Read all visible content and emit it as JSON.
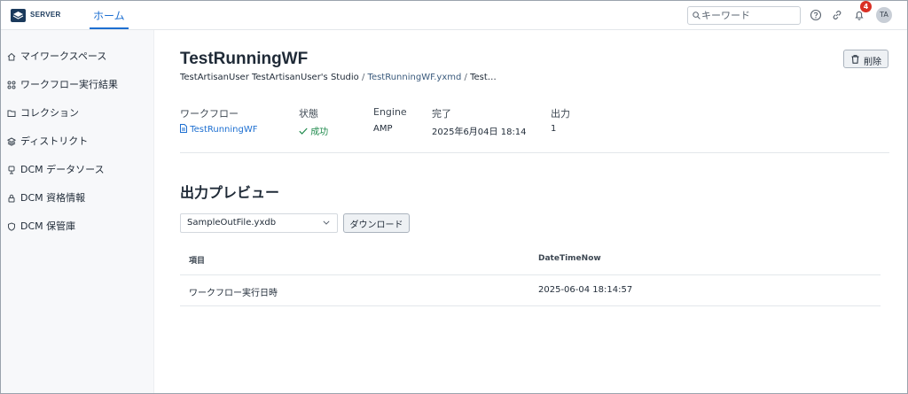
{
  "header": {
    "logo_text": "SERVER",
    "home_tab": "ホーム",
    "search_placeholder": "キーワード",
    "notification_count": "4",
    "avatar_initials": "TA"
  },
  "sidebar": {
    "items": [
      {
        "label": "マイワークスペース",
        "icon": "home-icon"
      },
      {
        "label": "ワークフロー実行結果",
        "icon": "flow-icon"
      },
      {
        "label": "コレクション",
        "icon": "folder-icon"
      },
      {
        "label": "ディストリクト",
        "icon": "layers-icon"
      },
      {
        "label": "DCM データソース",
        "icon": "datasource-icon"
      },
      {
        "label": "DCM 資格情報",
        "icon": "lock-icon"
      },
      {
        "label": "DCM 保管庫",
        "icon": "shield-icon"
      }
    ]
  },
  "page": {
    "title": "TestRunningWF",
    "breadcrumb": {
      "owner": "TestArtisanUser TestArtisanUser's Studio",
      "sep": " / ",
      "file": "TestRunningWF.yxmd",
      "tail": "Test…"
    },
    "delete_label": "削除"
  },
  "meta": {
    "labels": {
      "workflow": "ワークフロー",
      "status": "状態",
      "engine": "Engine",
      "completed": "完了",
      "output": "出力"
    },
    "values": {
      "workflow": "TestRunningWF",
      "status": "成功",
      "engine": "AMP",
      "completed": "2025年6月04日 18:14",
      "output": "1"
    }
  },
  "preview": {
    "title": "出力プレビュー",
    "selected_file": "SampleOutFile.yxdb",
    "download_label": "ダウンロード",
    "columns": [
      "項目",
      "DateTimeNow"
    ],
    "rows": [
      [
        "ワークフロー実行日時",
        "2025-06-04 18:14:57"
      ]
    ]
  },
  "colors": {
    "accent": "#1d6fd1",
    "success": "#1f8a4c",
    "badge": "#d93025",
    "brand": "#1b3a5c"
  }
}
